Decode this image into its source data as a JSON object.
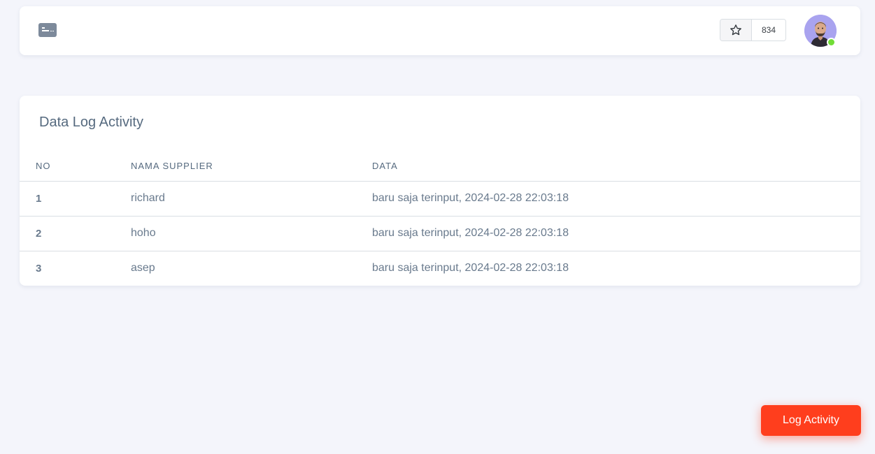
{
  "navbar": {
    "menu_icon": "keyboard-icon",
    "star_icon": "star-icon",
    "star_count": "834",
    "avatar_status_color": "#71dd37"
  },
  "card": {
    "title": "Data Log Activity",
    "columns": [
      "NO",
      "NAMA SUPPLIER",
      "DATA"
    ],
    "rows": [
      {
        "no": "1",
        "nama": "richard",
        "data": "baru saja terinput, 2024-02-28 22:03:18"
      },
      {
        "no": "2",
        "nama": "hoho",
        "data": "baru saja terinput, 2024-02-28 22:03:18"
      },
      {
        "no": "3",
        "nama": "asep",
        "data": "baru saja terinput, 2024-02-28 22:03:18"
      }
    ]
  },
  "floating_button": {
    "label": "Log Activity",
    "color": "#ff3e1d"
  }
}
